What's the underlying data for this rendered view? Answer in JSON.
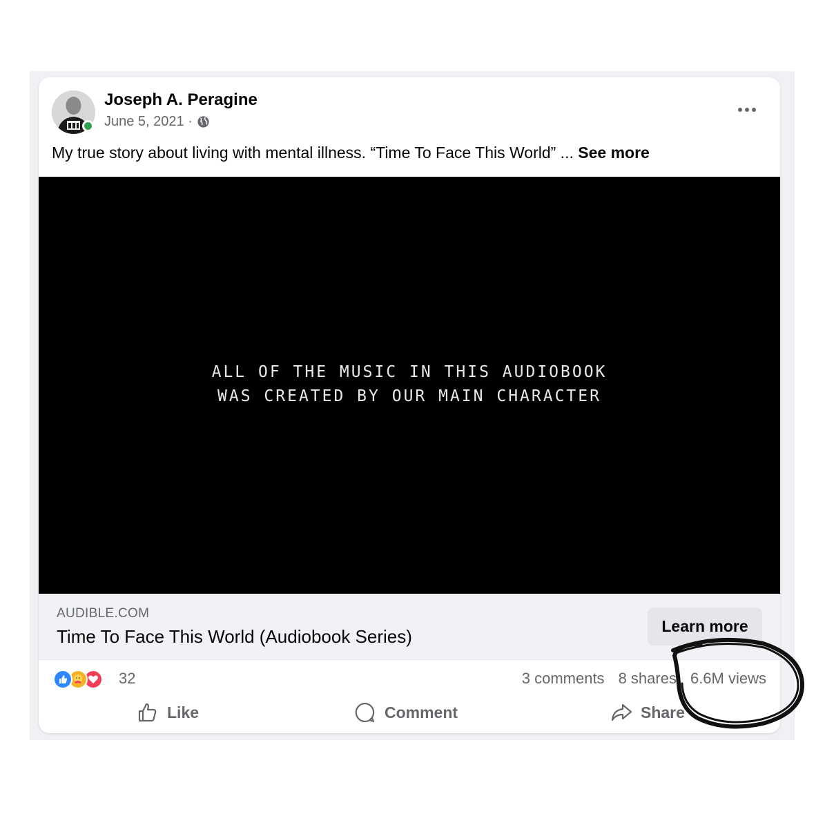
{
  "post": {
    "author": "Joseph A. Peragine",
    "date": "June 5, 2021 ·",
    "audience_icon": "globe-icon",
    "caption": "My true story about living with mental illness. “Time To Face This World” ...",
    "see_more": "See more"
  },
  "video": {
    "line1": "ALL OF THE MUSIC IN THIS AUDIOBOOK",
    "line2": "WAS CREATED BY OUR MAIN CHARACTER"
  },
  "link_preview": {
    "domain": "AUDIBLE.COM",
    "title": "Time To Face This World (Audiobook Series)",
    "cta": "Learn more"
  },
  "engagement": {
    "reaction_icons": [
      "like-reaction-icon",
      "care-reaction-icon",
      "love-reaction-icon"
    ],
    "reaction_count": "32",
    "comments": "3 comments",
    "shares": "8 shares",
    "views": "6.6M views"
  },
  "actions": {
    "like": "Like",
    "comment": "Comment",
    "share": "Share"
  },
  "colors": {
    "like_blue": "#2d88ff",
    "care_yellow": "#f7b125",
    "love_red": "#f33e58",
    "online_green": "#31a24c",
    "secondary_text": "#65676b"
  }
}
